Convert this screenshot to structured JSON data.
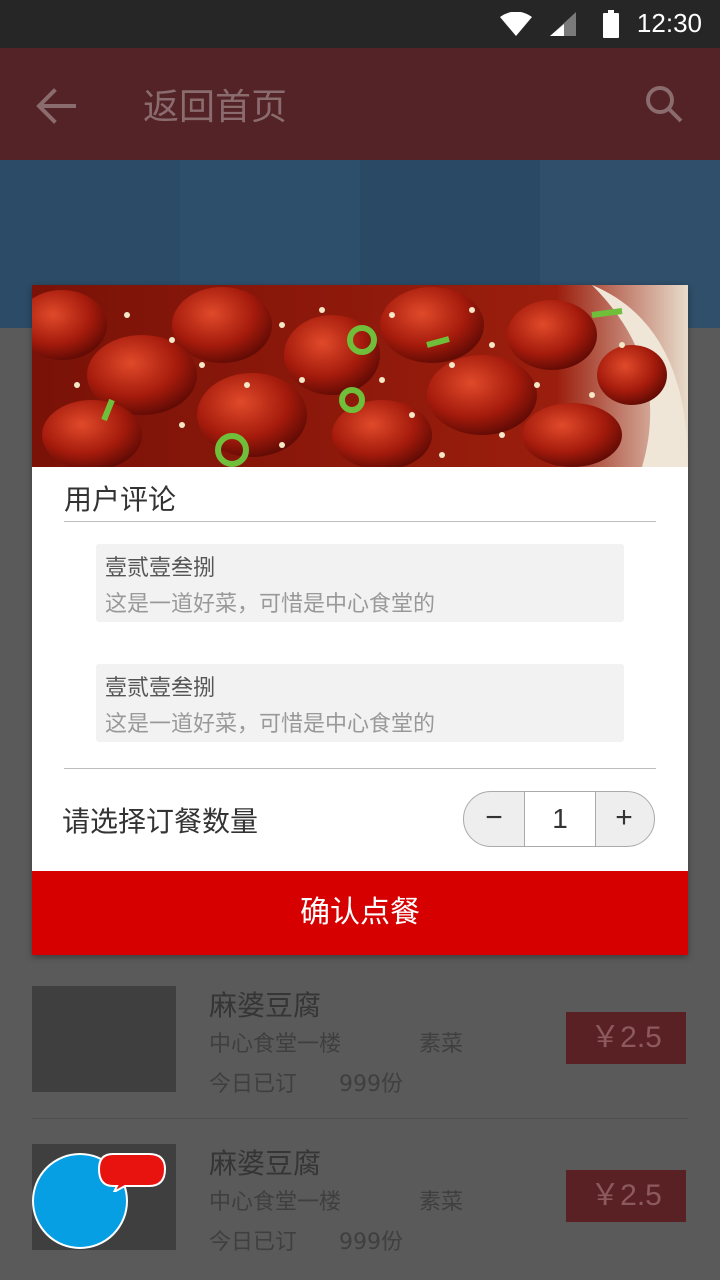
{
  "status_bar": {
    "time": "12:30"
  },
  "app_bar": {
    "title": "返回首页"
  },
  "dialog": {
    "section_title": "用户评论",
    "comments": [
      {
        "author": "壹贰壹叁捌",
        "text": "这是一道好菜，可惜是中心食堂的"
      },
      {
        "author": "壹贰壹叁捌",
        "text": "这是一道好菜，可惜是中心食堂的"
      }
    ],
    "quantity_label": "请选择订餐数量",
    "quantity_minus": "−",
    "quantity_value": "1",
    "quantity_plus": "+",
    "confirm_label": "确认点餐"
  },
  "list": [
    {
      "name": "麻婆豆腐",
      "location": "中心食堂一楼",
      "tag": "素菜",
      "today_label": "今日已订",
      "count": "999份",
      "price": "￥2.5"
    },
    {
      "name": "麻婆豆腐",
      "location": "中心食堂一楼",
      "tag": "素菜",
      "today_label": "今日已订",
      "count": "999份",
      "price": "￥2.5"
    }
  ],
  "colors": {
    "confirm": "#d60000",
    "appbar": "#532327",
    "fab": "#069fe3"
  }
}
